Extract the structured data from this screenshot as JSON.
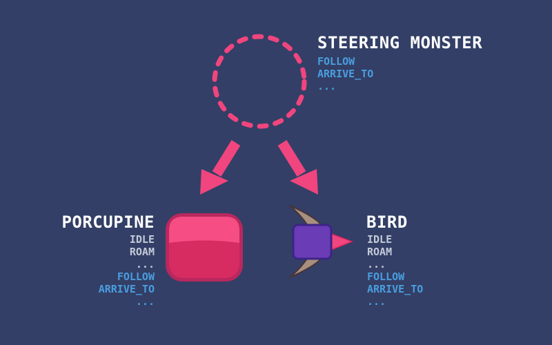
{
  "colors": {
    "background": "#333f66",
    "accent_pink": "#f0457e",
    "common_state": "#c3cbd9",
    "steering_state": "#4a9ee0",
    "title": "#ffffff",
    "bird_body": "#6a3cb5",
    "bird_wing": "#a89080"
  },
  "steering_monster": {
    "title": "STEERING MONSTER",
    "states": [
      "FOLLOW",
      "ARRIVE_TO",
      "..."
    ]
  },
  "porcupine": {
    "title": "PORCUPINE",
    "common_states": [
      "IDLE",
      "ROAM",
      "..."
    ],
    "steering_states": [
      "FOLLOW",
      "ARRIVE_TO",
      "..."
    ]
  },
  "bird": {
    "title": "BIRD",
    "common_states": [
      "IDLE",
      "ROAM",
      "..."
    ],
    "steering_states": [
      "FOLLOW",
      "ARRIVE_TO",
      "..."
    ]
  }
}
